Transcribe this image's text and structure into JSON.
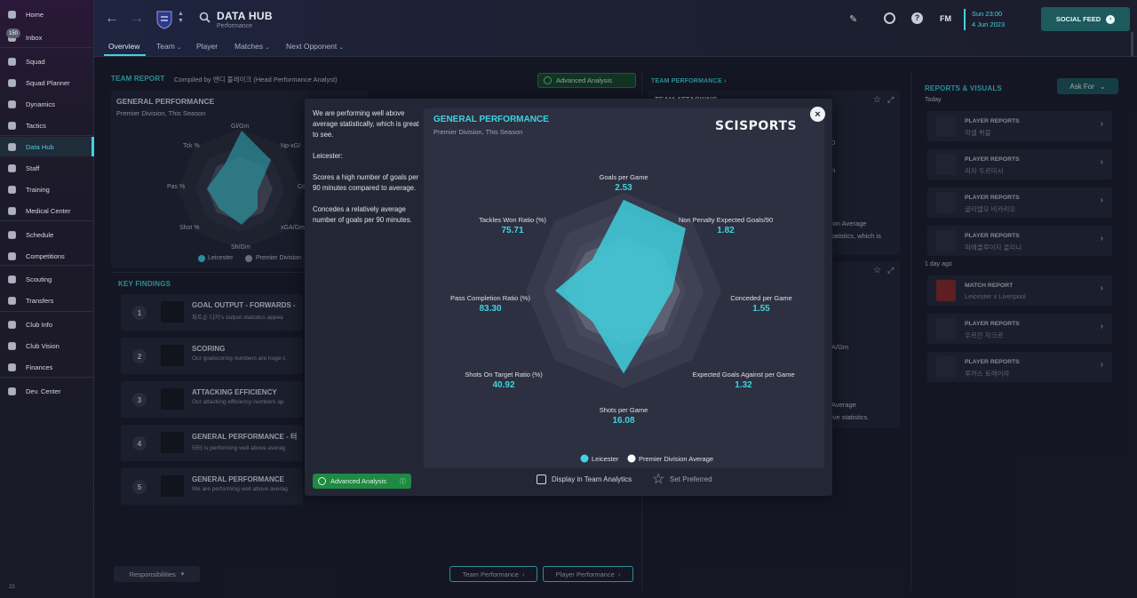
{
  "sidebar": {
    "inbox_count": "150",
    "items": [
      {
        "label": "Home",
        "icon": "home-icon"
      },
      {
        "label": "Inbox",
        "icon": "inbox-icon"
      },
      {
        "label": "Squad",
        "icon": "shirt-icon"
      },
      {
        "label": "Squad Planner",
        "icon": "clipboard-icon"
      },
      {
        "label": "Dynamics",
        "icon": "dynamics-icon"
      },
      {
        "label": "Tactics",
        "icon": "tactics-icon"
      },
      {
        "label": "Data Hub",
        "icon": "data-hub-icon"
      },
      {
        "label": "Staff",
        "icon": "staff-icon"
      },
      {
        "label": "Training",
        "icon": "training-icon"
      },
      {
        "label": "Medical Center",
        "icon": "medical-icon"
      },
      {
        "label": "Schedule",
        "icon": "calendar-icon"
      },
      {
        "label": "Competitions",
        "icon": "trophy-icon"
      },
      {
        "label": "Scouting",
        "icon": "scouting-icon"
      },
      {
        "label": "Transfers",
        "icon": "transfers-icon"
      },
      {
        "label": "Club Info",
        "icon": "shield-icon"
      },
      {
        "label": "Club Vision",
        "icon": "vision-icon"
      },
      {
        "label": "Finances",
        "icon": "finances-icon"
      },
      {
        "label": "Dev. Center",
        "icon": "dev-center-icon"
      }
    ],
    "footer": "23"
  },
  "header": {
    "title": "DATA HUB",
    "subtitle": "Performance",
    "tabs": [
      "Overview",
      "Team",
      "Player",
      "Matches",
      "Next Opponent"
    ],
    "fm_label": "FM",
    "date_line1": "Sun 23:00",
    "date_line2": "4 Jun 2023",
    "social_feed": "SOCIAL FEED"
  },
  "team_report": {
    "title": "TEAM REPORT",
    "compiled": "Compiled by 앤디 볼레이크 (Head Performance Analyst)",
    "advanced": "Advanced Analysis",
    "gp_title": "GENERAL PERFORMANCE",
    "gp_sub": "Premier Division, This Season",
    "radar_labels": [
      "Gl/Gm",
      "Np-xG/",
      "Co",
      "xGA/Gm",
      "Sh/Gm",
      "Shot %",
      "Pas %",
      "Tck %"
    ],
    "legend_a": "Leicester",
    "legend_b": "Premier Division"
  },
  "key_findings": {
    "title": "KEY FINDINGS",
    "items": [
      {
        "num": "1",
        "title": "GOAL OUTPUT - FORWARDS -",
        "sub": "파트손 다카's output statistics appea"
      },
      {
        "num": "2",
        "title": "SCORING",
        "sub": "Our goalscoring numbers are huge c"
      },
      {
        "num": "3",
        "title": "ATTACKING EFFICIENCY",
        "sub": "Our attacking efficiency numbers ap"
      },
      {
        "num": "4",
        "title": "GENERAL PERFORMANCE - 터",
        "sub": "터터 is performing well above averag"
      },
      {
        "num": "5",
        "title": "GENERAL PERFORMANCE",
        "sub": "We are performing well above averag"
      }
    ]
  },
  "bottom": {
    "responsibilities": "Responsibilities",
    "team_performance": "Team Performance",
    "player_performance": "Player Performance"
  },
  "team_performance": {
    "title": "TEAM PERFORMANCE",
    "fragments": [
      "TEAM ATTACKING",
      "0",
      "n",
      "ion Average",
      "tatistics, which is",
      "A/Gm",
      "Average",
      "ive statistics."
    ]
  },
  "reports": {
    "title": "REPORTS & VISUALS",
    "ask_for": "Ask For",
    "today": "Today",
    "day_ago": "1 day ago",
    "items": [
      {
        "type": "PLAYER REPORTS",
        "name": "악셀 뷔블"
      },
      {
        "type": "PLAYER REPORTS",
        "name": "리자 두르미시"
      },
      {
        "type": "PLAYER REPORTS",
        "name": "굴리엘모 비카리오"
      },
      {
        "type": "PLAYER REPORTS",
        "name": "피에클루이지 골리니"
      },
      {
        "type": "MATCH REPORT",
        "name": "Leicester v Liverpool"
      },
      {
        "type": "PLAYER REPORTS",
        "name": "우르잔 자크르"
      },
      {
        "type": "PLAYER REPORTS",
        "name": "루카스 토레이라"
      }
    ]
  },
  "modal": {
    "summary": "We are performing well above average statistically, which is great to see.",
    "team": "Leicester:",
    "point1": "Scores a high number of goals per 90 minutes compared to average.",
    "point2": "Concedes a relatively average number of goals per 90 minutes.",
    "advanced": "Advanced Analysis",
    "display_in_team_analytics": "Display in Team Analytics",
    "set_preferred": "Set Preferred",
    "brand": "SCISPORTS"
  },
  "chart_data": {
    "type": "radar",
    "title": "GENERAL PERFORMANCE",
    "subtitle": "Premier Division, This Season",
    "axes": [
      {
        "label": "Goals per Game",
        "value": "2.53",
        "team": 0.93,
        "avg": 0.55
      },
      {
        "label": "Non Penalty Expected Goals/90",
        "value": "1.82",
        "team": 0.9,
        "avg": 0.55
      },
      {
        "label": "Conceded per Game",
        "value": "1.55",
        "team": 0.5,
        "avg": 0.58
      },
      {
        "label": "Expected Goals Against per Game",
        "value": "1.32",
        "team": 0.45,
        "avg": 0.58
      },
      {
        "label": "Shots per Game",
        "value": "16.08",
        "team": 0.85,
        "avg": 0.55
      },
      {
        "label": "Shots On Target Ratio (%)",
        "value": "40.92",
        "team": 0.45,
        "avg": 0.55
      },
      {
        "label": "Pass Completion Ratio (%)",
        "value": "83.30",
        "team": 0.7,
        "avg": 0.6
      },
      {
        "label": "Tackles Won Ratio (%)",
        "value": "75.71",
        "team": 0.45,
        "avg": 0.55
      }
    ],
    "legend": [
      "Leicester",
      "Premier Division Average"
    ],
    "colors": {
      "team": "#3fd3e0",
      "avg": "#ffffff"
    }
  }
}
